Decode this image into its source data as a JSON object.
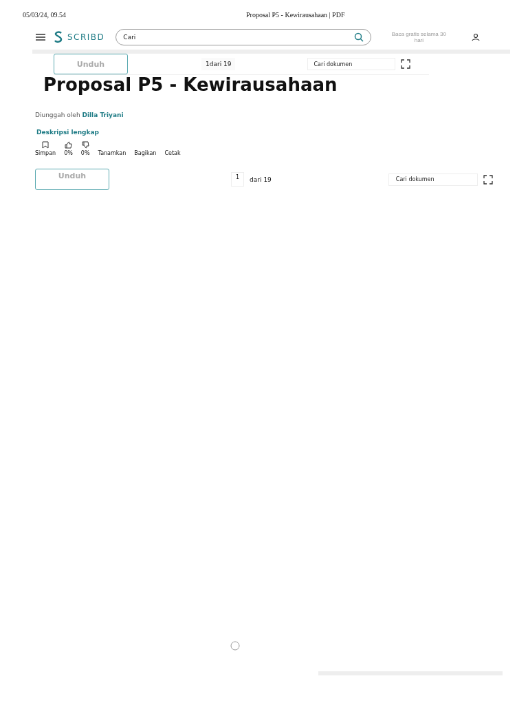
{
  "print_header": {
    "datetime": "05/03/24, 09.54",
    "title": "Proposal P5 - Kewirausahaan | PDF"
  },
  "nav": {
    "logo": "SCRIBD",
    "search": {
      "value": "Cari"
    },
    "promo": "Baca gratis selama 30 hari"
  },
  "toolbar_top": {
    "download": "Unduh",
    "page": "1",
    "page_of": "dari 19",
    "doc_search": {
      "placeholder": "Cari dokumen"
    }
  },
  "title": "Proposal P5 - Kewirausahaan",
  "uploader": {
    "label": "Diunggah oleh",
    "name": "Dilla Triyani"
  },
  "description_link": "Deskripsi lengkap",
  "actions": [
    {
      "kind": "save",
      "label": "Simpan"
    },
    {
      "kind": "like",
      "label": "0%"
    },
    {
      "kind": "dislike",
      "label": "0%"
    },
    {
      "kind": "plain",
      "label": "Tanamkan"
    },
    {
      "kind": "plain",
      "label": "Bagikan"
    },
    {
      "kind": "plain",
      "label": "Cetak"
    }
  ],
  "toolbar": {
    "download": "Unduh",
    "page": "1",
    "page_of": "dari 19",
    "doc_search": {
      "placeholder": "Cari dokumen"
    }
  }
}
